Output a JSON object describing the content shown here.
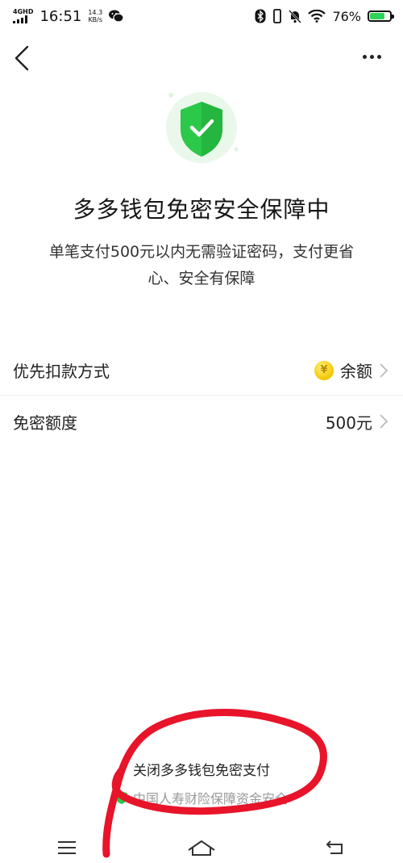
{
  "status_bar": {
    "network": "4GHD",
    "time": "16:51",
    "speed_value": "14.3",
    "speed_unit": "KB/s",
    "battery": "76%",
    "battery_level": 0.76
  },
  "page": {
    "title": "多多钱包免密安全保障中",
    "description": "单笔支付500元以内无需验证密码，支付更省心、安全有保障"
  },
  "rows": [
    {
      "label": "优先扣款方式",
      "value": "余额",
      "coin_symbol": "¥"
    },
    {
      "label": "免密额度",
      "value": "500元"
    }
  ],
  "footer": {
    "close_label": "关闭多多钱包免密支付",
    "insurance_text": "中国人寿财险保障资金安全"
  },
  "colors": {
    "shield_green": "#2cc84a",
    "annotation_red": "#e8142a"
  }
}
